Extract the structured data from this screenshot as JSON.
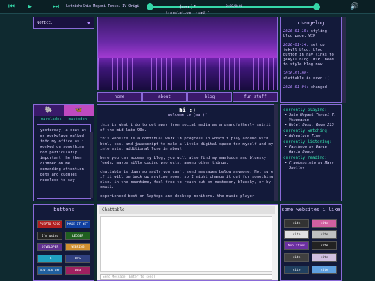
{
  "player": {
    "track": "Lotrich:Shin Megami Tensei IV Origi",
    "time": "0:00/0:00"
  },
  "notice": {
    "label": "NOTICE:"
  },
  "banner": {
    "title": "(mar)³",
    "subtitle": "translation: (sad)²"
  },
  "nav": [
    "home",
    "about",
    "blog",
    "fun stuff"
  ],
  "changelog": {
    "title": "changelog",
    "entries": [
      {
        "date": "2026-01-15:",
        "text": "styling blog page. WIP"
      },
      {
        "date": "2026-01-14:",
        "text": "set up jekyll blog. blog button in nav links to jekyll blog. WIP. need to style blog now"
      },
      {
        "date": "2026-01-08:",
        "text": "chattable is down :("
      },
      {
        "date": "2026-01-04:",
        "text": "changed"
      }
    ]
  },
  "mastodon": {
    "heading": "marolados - mastodon",
    "post": "yesterday, a scat at my workplace walked into my office as i worked on something not particularly important. he then climbed on me demanding attention, pets and cuddles. needless to say"
  },
  "main": {
    "heading": "hi :)",
    "welcome": "welcome to (mar)³",
    "p1": "this is what i do to get away from social media as a grandfatherly spirit of the mid-late 90s.",
    "p2": "this website is a continual work in progress in which i play around with html, css, and javascript to make a little digital space for myself and my interests. additional lore in about.",
    "p3": "here you can access my blog, you will also find my mastodon and bluesky feeds, maybe silly coding projects, among other things.",
    "p4": "chattable is down so sadly you can't send messages below anymore. Not sure if it will be back up anytime soon, so I might change it out for something else. in the meantime, feel free to reach out on mastodon, bluesky, or by email.",
    "p5": "experienced best on laptops and desktop monitors. the music player"
  },
  "status": {
    "playing_h": "currently playing:",
    "playing": [
      "Shin Megami Tensei V: Vengeance",
      "Hotel Dusk: Room 215"
    ],
    "watching_h": "currently watching:",
    "watching": [
      "Adventure Time"
    ],
    "listening_h": "currently listening:",
    "listening": [
      "Pantheon by Dance Gavin Dance"
    ],
    "reading_h": "currently reading:",
    "reading": [
      "Frankenstein by Mary Shelley"
    ]
  },
  "buttons": {
    "title": "buttons",
    "items": [
      "PUERTO RICO",
      "MAKE IT NET",
      "I’m using",
      "LEDGER",
      "DEVELOPER",
      "WEBRING",
      "IE",
      "HDS",
      "NEW ZEALAND",
      "WEB"
    ]
  },
  "chat": {
    "title": "Chattable",
    "placeholder": "Send Message (Enter to send)"
  },
  "websites": {
    "title": "some websites i like",
    "items": [
      "site",
      "site",
      "site",
      "site",
      "NeoCities",
      "site",
      "site",
      "site",
      "site",
      "site"
    ]
  }
}
